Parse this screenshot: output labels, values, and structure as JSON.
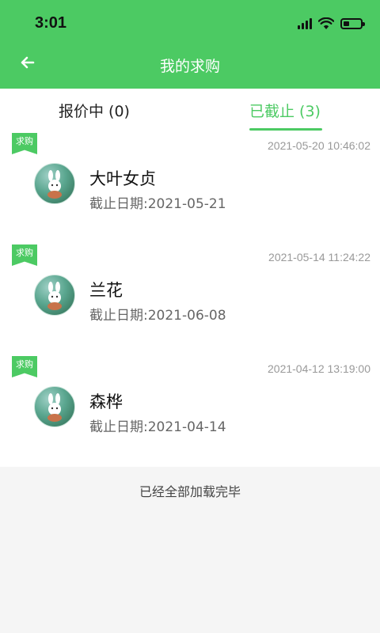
{
  "status_bar": {
    "time": "3:01",
    "icons": [
      "signal-icon",
      "wifi-icon",
      "battery-icon"
    ]
  },
  "nav": {
    "title": "我的求购",
    "back_icon": "back-arrow-icon"
  },
  "tabs": [
    {
      "label": "报价中 (0)",
      "selected": false
    },
    {
      "label": "已截止 (3)",
      "selected": true
    }
  ],
  "items": [
    {
      "tag": "求购",
      "timestamp": "2021-05-20 10:46:02",
      "name": "大叶女贞",
      "deadline": "截止日期:2021-05-21"
    },
    {
      "tag": "求购",
      "timestamp": "2021-05-14 11:24:22",
      "name": "兰花",
      "deadline": "截止日期:2021-06-08"
    },
    {
      "tag": "求购",
      "timestamp": "2021-04-12 13:19:00",
      "name": "森桦",
      "deadline": "截止日期:2021-04-14"
    }
  ],
  "footer": {
    "text": "已经全部加载完毕"
  },
  "colors": {
    "accent": "#4cca63",
    "muted_text": "#999999",
    "background": "#f5f5f5"
  }
}
